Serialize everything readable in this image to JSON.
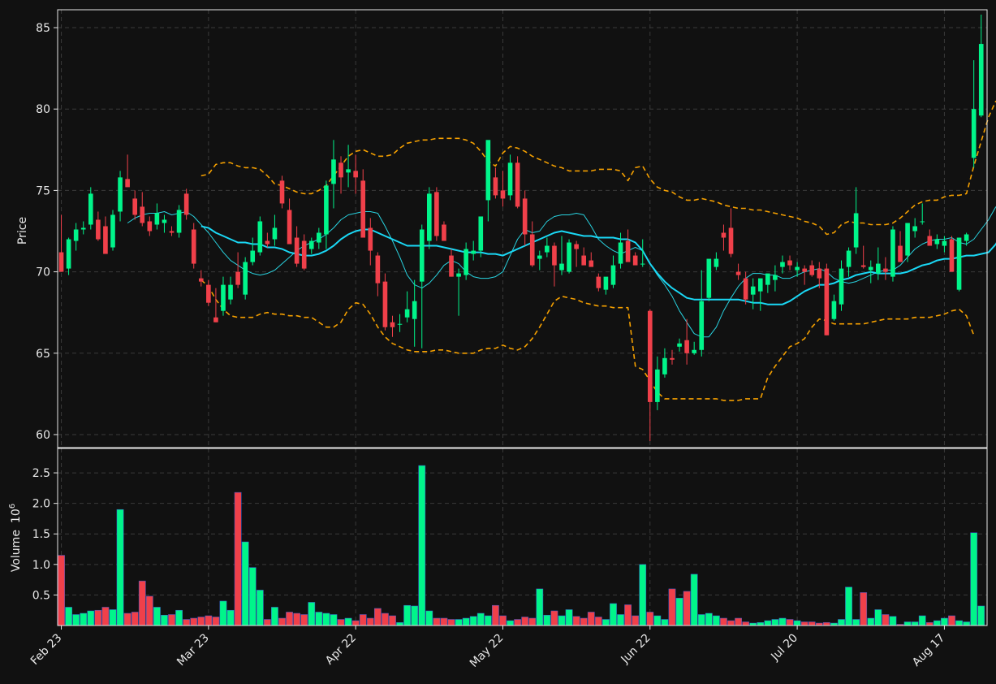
{
  "colors": {
    "background": "#111111",
    "up": "#00f58a",
    "down": "#f0404a",
    "ma_short": "#29d3e0",
    "ma_long": "#1ad8f5",
    "band": "#f5a000",
    "grid": "#3a3a3a",
    "axis": "#e8e8e8"
  },
  "chart_data": {
    "type": "candlestick",
    "grid": true,
    "price_axis": {
      "label": "Price",
      "ylim": [
        59.2,
        86.1
      ],
      "ticks": [
        60,
        65,
        70,
        75,
        80,
        85
      ]
    },
    "volume_axis": {
      "label": "Volume",
      "multiplier": "10",
      "multiplier_exp": "6",
      "ylim": [
        0,
        2.9
      ],
      "ticks": [
        "0.5",
        "1.0",
        "1.5",
        "2.0",
        "2.5"
      ]
    },
    "x_ticks": [
      {
        "index": 0,
        "label": "Feb 23"
      },
      {
        "index": 20,
        "label": "Mar 23"
      },
      {
        "index": 40,
        "label": "Apr 22"
      },
      {
        "index": 60,
        "label": "May 22"
      },
      {
        "index": 80,
        "label": "Jun 22"
      },
      {
        "index": 100,
        "label": "Jul 20"
      },
      {
        "index": 120,
        "label": "Aug 17"
      }
    ],
    "candles": [
      [
        71.2,
        73.5,
        70.0,
        70.0,
        1.15
      ],
      [
        70.2,
        72.1,
        69.8,
        72.0,
        0.3
      ],
      [
        71.9,
        73.0,
        71.3,
        72.6,
        0.18
      ],
      [
        72.6,
        73.1,
        72.3,
        72.7,
        0.2
      ],
      [
        72.9,
        75.2,
        72.6,
        74.8,
        0.24
      ],
      [
        73.2,
        73.7,
        71.9,
        72.0,
        0.25
      ],
      [
        72.8,
        73.4,
        71.2,
        71.1,
        0.3
      ],
      [
        71.5,
        73.8,
        71.3,
        73.5,
        0.26
      ],
      [
        73.7,
        76.2,
        73.1,
        75.8,
        1.9
      ],
      [
        75.7,
        77.2,
        75.4,
        75.2,
        0.2
      ],
      [
        74.5,
        75.0,
        73.2,
        73.5,
        0.22
      ],
      [
        74.0,
        74.9,
        72.8,
        73.0,
        0.73
      ],
      [
        73.1,
        73.4,
        72.2,
        72.5,
        0.48
      ],
      [
        72.9,
        74.2,
        72.6,
        73.6,
        0.3
      ],
      [
        73.0,
        73.5,
        72.4,
        73.2,
        0.17
      ],
      [
        72.5,
        72.8,
        72.2,
        72.4,
        0.18
      ],
      [
        72.4,
        74.1,
        72.1,
        73.8,
        0.25
      ],
      [
        74.8,
        75.1,
        73.2,
        73.5,
        0.1
      ],
      [
        72.6,
        73.0,
        70.2,
        70.5,
        0.12
      ],
      [
        69.6,
        70.1,
        69.1,
        69.4,
        0.14
      ],
      [
        69.2,
        69.5,
        67.9,
        68.1,
        0.16
      ],
      [
        67.2,
        69.0,
        66.9,
        66.9,
        0.14
      ],
      [
        67.6,
        69.7,
        67.3,
        69.2,
        0.4
      ],
      [
        68.3,
        69.7,
        68.0,
        69.2,
        0.25
      ],
      [
        70.0,
        71.2,
        69.0,
        69.2,
        2.18
      ],
      [
        68.6,
        70.9,
        68.3,
        70.6,
        1.37
      ],
      [
        70.6,
        72.1,
        70.4,
        71.3,
        0.95
      ],
      [
        71.2,
        73.4,
        71.0,
        73.1,
        0.58
      ],
      [
        71.9,
        72.4,
        71.5,
        71.7,
        0.1
      ],
      [
        72.0,
        73.5,
        71.6,
        72.7,
        0.3
      ],
      [
        75.6,
        75.9,
        73.9,
        74.2,
        0.12
      ],
      [
        73.8,
        74.5,
        72.3,
        71.7,
        0.22
      ],
      [
        72.1,
        72.8,
        70.3,
        70.5,
        0.2
      ],
      [
        71.9,
        72.3,
        70.1,
        70.2,
        0.18
      ],
      [
        71.4,
        72.1,
        71.1,
        71.9,
        0.38
      ],
      [
        71.8,
        72.7,
        71.4,
        72.4,
        0.22
      ],
      [
        72.3,
        75.6,
        71.4,
        75.3,
        0.2
      ],
      [
        75.4,
        78.1,
        73.9,
        76.9,
        0.18
      ],
      [
        76.7,
        77.1,
        74.8,
        75.8,
        0.1
      ],
      [
        76.1,
        77.8,
        75.2,
        76.3,
        0.12
      ],
      [
        76.2,
        77.2,
        74.8,
        75.8,
        0.08
      ],
      [
        75.6,
        76.3,
        72.8,
        72.1,
        0.18
      ],
      [
        72.7,
        73.3,
        70.4,
        71.3,
        0.12
      ],
      [
        71.0,
        71.2,
        68.5,
        69.3,
        0.28
      ],
      [
        69.4,
        69.9,
        66.4,
        66.6,
        0.2
      ],
      [
        66.9,
        67.3,
        66.0,
        66.6,
        0.16
      ],
      [
        66.8,
        67.4,
        66.3,
        66.8,
        0.05
      ],
      [
        67.2,
        68.8,
        66.9,
        67.7,
        0.33
      ],
      [
        67.1,
        69.5,
        65.4,
        68.2,
        0.32
      ],
      [
        69.4,
        72.9,
        65.3,
        72.6,
        2.62
      ],
      [
        71.9,
        75.2,
        71.4,
        74.8,
        0.24
      ],
      [
        74.9,
        75.2,
        71.9,
        72.2,
        0.12
      ],
      [
        72.9,
        73.1,
        71.9,
        71.9,
        0.12
      ],
      [
        71.0,
        71.4,
        69.7,
        69.7,
        0.1
      ],
      [
        69.7,
        70.2,
        67.3,
        69.9,
        0.1
      ],
      [
        69.8,
        71.8,
        69.5,
        71.4,
        0.12
      ],
      [
        71.1,
        71.9,
        70.7,
        71.3,
        0.15
      ],
      [
        71.3,
        73.1,
        70.9,
        73.4,
        0.2
      ],
      [
        74.4,
        77.2,
        73.1,
        78.1,
        0.16
      ],
      [
        75.8,
        76.4,
        74.5,
        74.7,
        0.33
      ],
      [
        75.0,
        76.2,
        74.0,
        74.5,
        0.16
      ],
      [
        74.7,
        77.2,
        74.4,
        76.7,
        0.08
      ],
      [
        76.7,
        77.1,
        73.9,
        74.0,
        0.1
      ],
      [
        74.5,
        75.0,
        71.6,
        72.3,
        0.14
      ],
      [
        72.3,
        73.1,
        70.3,
        70.4,
        0.12
      ],
      [
        70.8,
        71.3,
        70.1,
        71.0,
        0.6
      ],
      [
        71.2,
        72.1,
        70.9,
        71.6,
        0.17
      ],
      [
        71.6,
        71.8,
        69.1,
        70.4,
        0.24
      ],
      [
        70.1,
        72.2,
        69.8,
        70.5,
        0.16
      ],
      [
        70.0,
        72.0,
        69.9,
        71.8,
        0.26
      ],
      [
        71.7,
        71.9,
        70.3,
        71.4,
        0.15
      ],
      [
        71.0,
        71.5,
        70.8,
        70.4,
        0.12
      ],
      [
        70.7,
        71.2,
        70.5,
        70.3,
        0.22
      ],
      [
        69.7,
        69.9,
        68.8,
        69.0,
        0.14
      ],
      [
        68.9,
        69.6,
        68.6,
        69.7,
        0.1
      ],
      [
        69.2,
        71.0,
        69.0,
        70.4,
        0.36
      ],
      [
        70.5,
        72.4,
        70.2,
        71.8,
        0.18
      ],
      [
        71.9,
        72.6,
        71.0,
        70.6,
        0.34
      ],
      [
        71.0,
        71.2,
        70.8,
        70.4,
        0.16
      ],
      [
        70.5,
        72.0,
        70.3,
        70.5,
        1.0
      ],
      [
        67.6,
        67.7,
        59.6,
        62.0,
        0.22
      ],
      [
        62.0,
        64.8,
        61.5,
        64.0,
        0.16
      ],
      [
        63.7,
        65.3,
        63.5,
        64.7,
        0.1
      ],
      [
        64.7,
        65.2,
        64.3,
        64.6,
        0.6
      ],
      [
        65.4,
        65.9,
        65.1,
        65.6,
        0.45
      ],
      [
        65.8,
        67.1,
        64.3,
        65.0,
        0.56
      ],
      [
        65.0,
        65.7,
        64.9,
        65.2,
        0.84
      ],
      [
        65.2,
        70.1,
        64.8,
        68.2,
        0.18
      ],
      [
        68.4,
        70.6,
        68.2,
        70.8,
        0.2
      ],
      [
        70.3,
        71.2,
        70.1,
        70.8,
        0.16
      ],
      [
        72.4,
        72.9,
        71.3,
        72.1,
        0.12
      ],
      [
        72.7,
        73.9,
        70.9,
        71.1,
        0.08
      ],
      [
        70.0,
        70.5,
        69.5,
        69.8,
        0.12
      ],
      [
        69.6,
        70.0,
        68.0,
        68.3,
        0.06
      ],
      [
        68.6,
        69.6,
        67.7,
        69.1,
        0.04
      ],
      [
        68.8,
        69.4,
        67.6,
        69.6,
        0.05
      ],
      [
        69.2,
        69.7,
        68.7,
        69.9,
        0.08
      ],
      [
        69.5,
        70.4,
        68.8,
        69.8,
        0.1
      ],
      [
        70.3,
        71.0,
        69.9,
        70.6,
        0.12
      ],
      [
        70.7,
        71.0,
        70.1,
        70.4,
        0.1
      ],
      [
        70.1,
        70.6,
        69.7,
        70.3,
        0.08
      ],
      [
        70.2,
        70.4,
        69.2,
        70.0,
        0.06
      ],
      [
        70.4,
        70.7,
        69.7,
        69.8,
        0.06
      ],
      [
        70.2,
        70.6,
        69.0,
        69.6,
        0.04
      ],
      [
        70.2,
        70.5,
        66.1,
        66.1,
        0.05
      ],
      [
        67.1,
        68.6,
        67.0,
        68.2,
        0.04
      ],
      [
        68.0,
        70.7,
        67.6,
        70.2,
        0.1
      ],
      [
        70.3,
        71.5,
        69.7,
        71.3,
        0.63
      ],
      [
        71.5,
        75.2,
        71.1,
        73.6,
        0.1
      ],
      [
        70.4,
        71.6,
        70.2,
        70.3,
        0.54
      ],
      [
        70.1,
        70.7,
        69.3,
        70.3,
        0.12
      ],
      [
        69.9,
        71.5,
        69.5,
        70.5,
        0.26
      ],
      [
        70.2,
        70.9,
        69.5,
        70.0,
        0.18
      ],
      [
        69.7,
        72.8,
        69.4,
        72.6,
        0.15
      ],
      [
        71.6,
        72.5,
        71.3,
        70.6,
        0.02
      ],
      [
        71.0,
        72.9,
        70.6,
        73.0,
        0.06
      ],
      [
        72.5,
        73.3,
        72.1,
        72.8,
        0.06
      ],
      [
        73.1,
        74.2,
        72.9,
        73.1,
        0.16
      ],
      [
        72.2,
        72.6,
        71.9,
        71.6,
        0.05
      ],
      [
        71.7,
        72.3,
        71.4,
        72.0,
        0.08
      ],
      [
        71.6,
        72.2,
        71.2,
        71.9,
        0.12
      ],
      [
        72.0,
        72.2,
        71.0,
        70.0,
        0.16
      ],
      [
        68.9,
        72.1,
        68.8,
        72.1,
        0.08
      ],
      [
        71.9,
        72.4,
        71.6,
        72.3,
        0.06
      ],
      [
        77.0,
        83.0,
        76.4,
        80.0,
        1.52
      ],
      [
        79.6,
        85.8,
        79.5,
        84.0,
        0.32
      ]
    ],
    "ma_short": [
      null,
      null,
      null,
      null,
      null,
      null,
      null,
      null,
      null,
      73.0,
      73.3,
      73.5,
      73.6,
      73.6,
      73.7,
      73.5,
      73.6,
      73.7,
      73.4,
      72.9,
      72.4,
      71.8,
      71.2,
      70.7,
      70.4,
      70.1,
      69.9,
      69.8,
      69.9,
      70.1,
      70.5,
      70.9,
      71.3,
      71.6,
      71.8,
      72.0,
      72.3,
      72.7,
      73.2,
      73.5,
      73.6,
      73.7,
      73.7,
      73.6,
      72.8,
      71.9,
      70.9,
      69.8,
      69.2,
      69.0,
      69.3,
      69.8,
      70.4,
      70.7,
      70.5,
      70.0,
      69.7,
      69.6,
      69.6,
      69.7,
      70.0,
      71.0,
      72.0,
      72.6,
      72.4,
      72.5,
      73.1,
      73.4,
      73.5,
      73.5,
      73.6,
      73.5,
      72.8,
      72.0,
      71.6,
      71.3,
      71.1,
      71.3,
      71.5,
      71.3,
      70.5,
      69.8,
      69.2,
      68.5,
      67.6,
      66.9,
      66.2,
      66.0,
      66.0,
      66.6,
      67.6,
      68.4,
      69.1,
      69.6,
      69.9,
      69.9,
      69.8,
      69.8,
      69.6,
      69.6,
      69.8,
      70.0,
      70.1,
      70.2,
      70.0,
      69.6,
      69.4,
      69.3,
      69.4,
      69.6,
      69.8,
      70.0,
      70.1,
      70.1,
      70.4,
      70.9,
      71.4,
      71.7,
      71.9,
      72.0,
      72.0,
      72.1,
      71.8,
      71.7,
      72.0,
      72.6,
      73.2,
      74.0
    ],
    "ma_long": [
      null,
      null,
      null,
      null,
      null,
      null,
      null,
      null,
      null,
      null,
      null,
      null,
      null,
      null,
      null,
      null,
      null,
      null,
      null,
      72.8,
      72.7,
      72.4,
      72.2,
      72.0,
      71.8,
      71.8,
      71.7,
      71.7,
      71.5,
      71.5,
      71.4,
      71.2,
      71.1,
      71.0,
      71.0,
      71.1,
      71.3,
      71.6,
      72.0,
      72.3,
      72.5,
      72.6,
      72.6,
      72.4,
      72.2,
      72.0,
      71.8,
      71.6,
      71.6,
      71.6,
      71.6,
      71.6,
      71.5,
      71.4,
      71.3,
      71.2,
      71.2,
      71.2,
      71.1,
      71.1,
      71.0,
      71.2,
      71.4,
      71.6,
      71.8,
      72.0,
      72.2,
      72.4,
      72.5,
      72.4,
      72.3,
      72.2,
      72.2,
      72.1,
      72.1,
      72.1,
      72.0,
      72.0,
      71.8,
      71.3,
      70.5,
      69.9,
      69.4,
      69.0,
      68.7,
      68.4,
      68.3,
      68.3,
      68.3,
      68.3,
      68.3,
      68.3,
      68.3,
      68.2,
      68.1,
      68.1,
      68.0,
      68.0,
      68.0,
      68.2,
      68.5,
      68.8,
      69.0,
      69.2,
      69.2,
      69.3,
      69.5,
      69.6,
      69.8,
      69.9,
      70.0,
      69.9,
      69.9,
      69.9,
      69.9,
      70.0,
      70.2,
      70.4,
      70.5,
      70.7,
      70.8,
      70.8,
      70.9,
      71.0,
      71.0,
      71.1,
      71.2,
      71.7,
      72.6
    ],
    "band_upper": [
      null,
      null,
      null,
      null,
      null,
      null,
      null,
      null,
      null,
      null,
      null,
      null,
      null,
      null,
      null,
      null,
      null,
      null,
      null,
      75.9,
      76.0,
      76.6,
      76.7,
      76.7,
      76.5,
      76.4,
      76.4,
      76.3,
      75.9,
      75.4,
      75.3,
      75.1,
      74.9,
      74.8,
      74.8,
      75.0,
      75.3,
      75.9,
      76.5,
      77.1,
      77.4,
      77.5,
      77.3,
      77.1,
      77.1,
      77.2,
      77.6,
      77.9,
      78.0,
      78.1,
      78.1,
      78.2,
      78.2,
      78.2,
      78.2,
      78.1,
      77.9,
      77.4,
      76.8,
      76.5,
      77.3,
      77.7,
      77.6,
      77.4,
      77.1,
      76.9,
      76.7,
      76.5,
      76.4,
      76.2,
      76.2,
      76.2,
      76.2,
      76.3,
      76.3,
      76.3,
      76.2,
      75.6,
      76.4,
      76.5,
      75.7,
      75.2,
      75.0,
      74.9,
      74.6,
      74.4,
      74.4,
      74.5,
      74.4,
      74.3,
      74.1,
      74.0,
      73.9,
      73.9,
      73.8,
      73.8,
      73.7,
      73.6,
      73.5,
      73.4,
      73.3,
      73.1,
      73.0,
      72.8,
      72.3,
      72.4,
      72.9,
      73.1,
      73.0,
      73.0,
      72.9,
      72.9,
      72.9,
      73.0,
      73.3,
      73.7,
      74.1,
      74.3,
      74.4,
      74.4,
      74.6,
      74.7,
      74.7,
      74.8,
      76.5,
      78.0,
      79.5,
      80.5
    ],
    "band_lower": [
      null,
      null,
      null,
      null,
      null,
      null,
      null,
      null,
      null,
      null,
      null,
      null,
      null,
      null,
      null,
      null,
      null,
      null,
      null,
      69.5,
      69.1,
      68.3,
      67.7,
      67.3,
      67.2,
      67.2,
      67.2,
      67.4,
      67.5,
      67.4,
      67.4,
      67.3,
      67.3,
      67.2,
      67.2,
      66.9,
      66.6,
      66.6,
      66.9,
      67.7,
      68.1,
      68.0,
      67.4,
      66.6,
      66.0,
      65.6,
      65.4,
      65.2,
      65.1,
      65.1,
      65.1,
      65.2,
      65.2,
      65.1,
      65.0,
      65.0,
      65.0,
      65.2,
      65.3,
      65.3,
      65.5,
      65.3,
      65.2,
      65.4,
      65.9,
      66.6,
      67.4,
      68.2,
      68.5,
      68.4,
      68.3,
      68.1,
      68.0,
      67.9,
      67.9,
      67.8,
      67.8,
      67.8,
      64.2,
      64.0,
      63.3,
      62.6,
      62.2,
      62.2,
      62.2,
      62.2,
      62.2,
      62.2,
      62.2,
      62.2,
      62.1,
      62.1,
      62.1,
      62.2,
      62.2,
      62.2,
      63.5,
      64.2,
      64.8,
      65.4,
      65.6,
      65.9,
      66.6,
      67.1,
      67.0,
      66.8,
      66.8,
      66.8,
      66.8,
      66.8,
      66.9,
      67.0,
      67.1,
      67.1,
      67.1,
      67.1,
      67.2,
      67.2,
      67.2,
      67.3,
      67.4,
      67.6,
      67.7,
      67.3,
      66.1
    ]
  }
}
